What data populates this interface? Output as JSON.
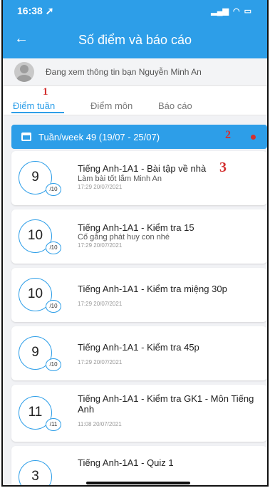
{
  "status_bar": {
    "time": "16:38",
    "location_icon": "location-arrow-icon",
    "signal_icon": "signal-icon",
    "wifi_icon": "wifi-icon",
    "battery_icon": "battery-icon"
  },
  "header": {
    "title": "Số điểm và báo cáo",
    "back_icon": "arrow-left-icon"
  },
  "user": {
    "viewing_text": "Đang xem thông tin bạn Nguyễn Minh An"
  },
  "tabs": [
    {
      "label": "Điểm tuần",
      "active": true
    },
    {
      "label": "Điểm môn",
      "active": false
    },
    {
      "label": "Báo cáo",
      "active": false
    }
  ],
  "week_filter": {
    "label": "Tuần/week 49 (19/07 - 25/07)"
  },
  "annotations": [
    "1",
    "2",
    "3"
  ],
  "scores": [
    {
      "score": "9",
      "max": "/10",
      "title": "Tiếng Anh-1A1 - Bài tập về nhà",
      "note": "Làm bài tốt lắm Minh An",
      "time": "17:29 20/07/2021"
    },
    {
      "score": "10",
      "max": "/10",
      "title": "Tiếng Anh-1A1 - Kiểm tra 15",
      "note": "Cố gắng phát huy con nhé",
      "time": "17:29 20/07/2021"
    },
    {
      "score": "10",
      "max": "/10",
      "title": "Tiếng Anh-1A1 - Kiểm tra miệng 30p",
      "note": "",
      "time": "17:29 20/07/2021"
    },
    {
      "score": "9",
      "max": "/10",
      "title": "Tiếng Anh-1A1 - Kiểm tra 45p",
      "note": "",
      "time": "17:29 20/07/2021"
    },
    {
      "score": "11",
      "max": "/11",
      "title": "Tiếng Anh-1A1 - Kiểm tra GK1 - Môn Tiếng Anh",
      "note": "",
      "time": "11:08 20/07/2021"
    },
    {
      "score": "3",
      "max": "",
      "title": "Tiếng Anh-1A1 - Quiz 1",
      "note": "",
      "time": ""
    }
  ],
  "colors": {
    "accent": "#2d9ee8",
    "annotation": "#d32f2f",
    "background": "#f1f2f5"
  }
}
